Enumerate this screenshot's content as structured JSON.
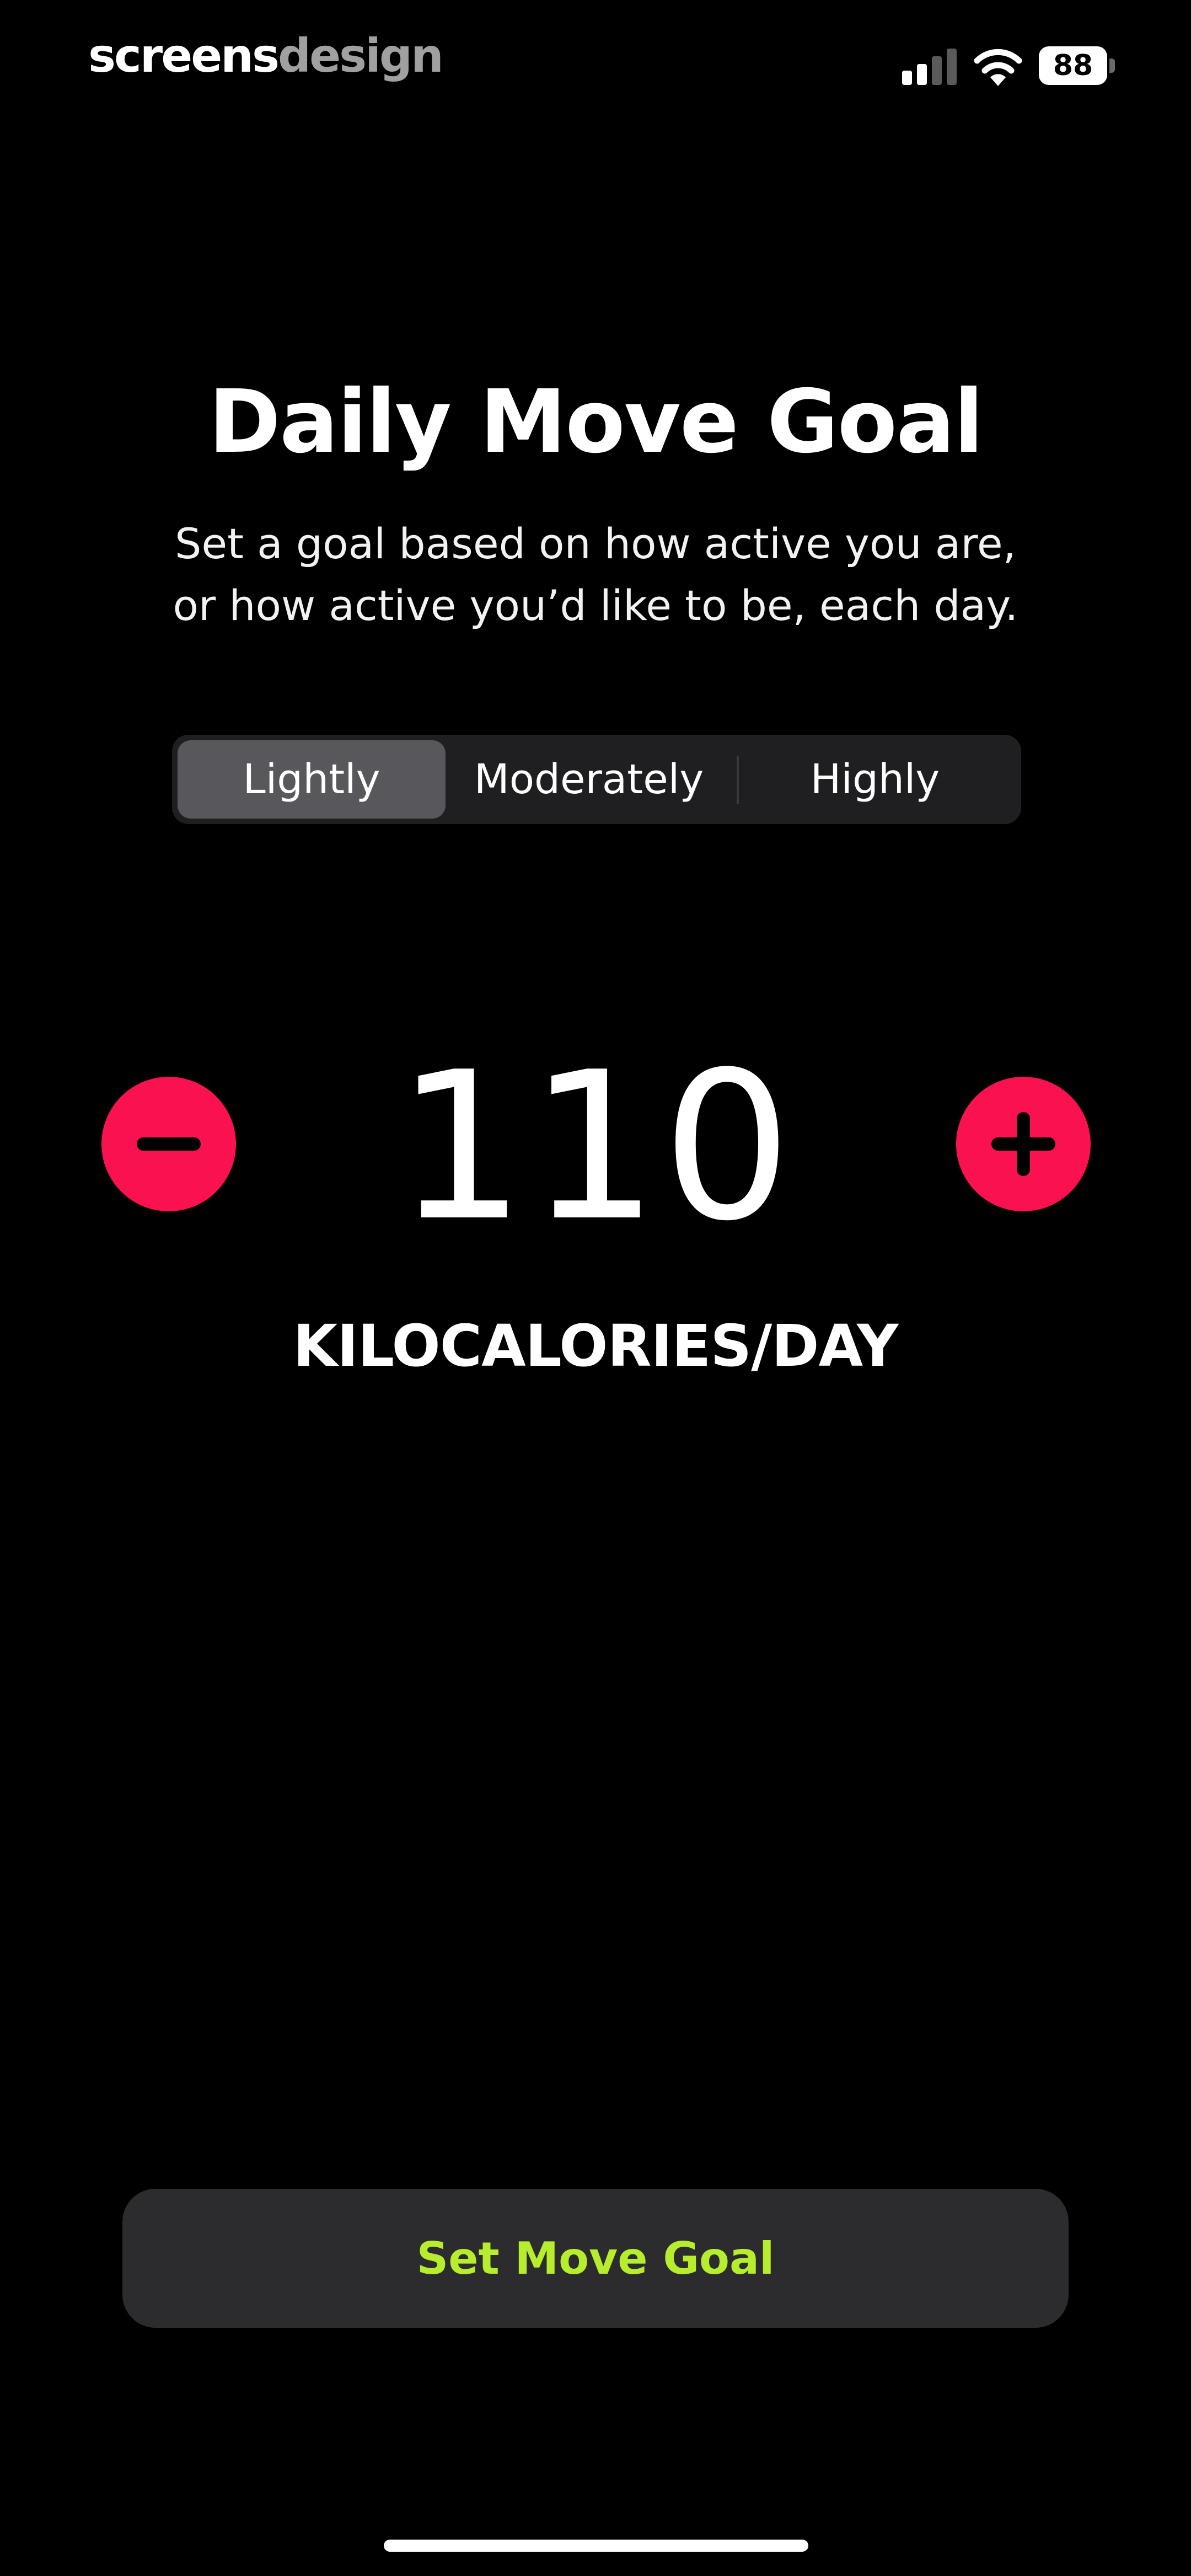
{
  "status_bar": {
    "brand_primary": "screens",
    "brand_secondary": "design",
    "battery_level": "88"
  },
  "header": {
    "title": "Daily Move Goal",
    "subtitle_line1": "Set a goal based on how active you are,",
    "subtitle_line2": "or how active you’d like to be, each day."
  },
  "activity_levels": {
    "options": [
      "Lightly",
      "Moderately",
      "Highly"
    ],
    "selected": "Lightly"
  },
  "goal": {
    "value": "110",
    "unit": "KILOCALORIES/DAY"
  },
  "actions": {
    "set_goal_label": "Set Move Goal"
  },
  "colors": {
    "background": "#000000",
    "stepper_accent": "#fa114f",
    "button_text": "#b6ee2d",
    "button_bg": "#2c2c2e",
    "segment_selected": "#58585c"
  },
  "icons": {
    "decrease": "minus-icon",
    "increase": "plus-icon",
    "signal": "cellular-signal-icon",
    "wifi": "wifi-icon"
  }
}
